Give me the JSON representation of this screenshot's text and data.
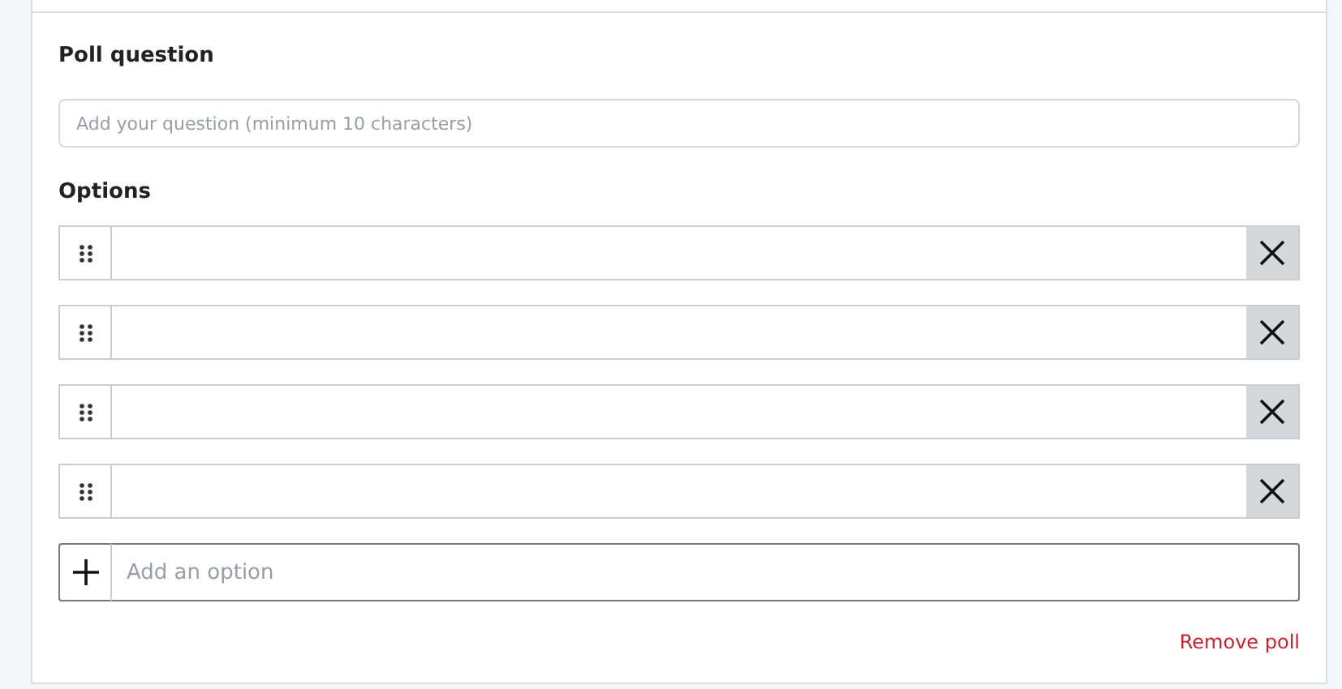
{
  "poll_question": {
    "label": "Poll question",
    "placeholder": "Add your question (minimum 10 characters)"
  },
  "options": {
    "label": "Options",
    "items": [
      {
        "kind": "text"
      },
      {
        "kind": "text"
      },
      {
        "kind": "text"
      },
      {
        "kind": "text"
      }
    ],
    "add_option": {
      "placeholder": "Add an option"
    }
  },
  "remove_link": "Remove poll"
}
